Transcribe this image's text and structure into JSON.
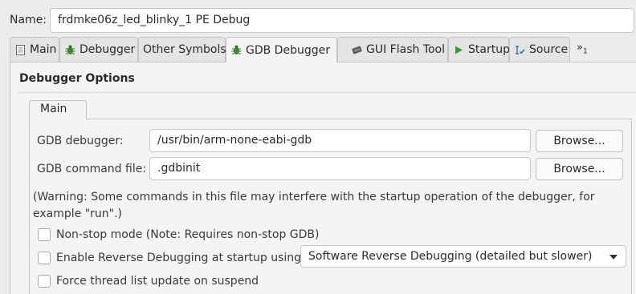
{
  "name": {
    "label": "Name:",
    "value": "frdmke06z_led_blinky_1 PE Debug"
  },
  "tabs": [
    {
      "label": "Main",
      "icon": "document-icon",
      "active": false
    },
    {
      "label": "Debugger",
      "icon": "bug-icon",
      "active": false
    },
    {
      "label": "Other Symbols",
      "icon": "",
      "active": false
    },
    {
      "label": "GDB Debugger",
      "icon": "bug-icon",
      "active": true
    },
    {
      "label": "GUI Flash Tool",
      "icon": "chip-icon",
      "active": false
    },
    {
      "label": "Startup",
      "icon": "play-icon",
      "active": false
    },
    {
      "label": "Source",
      "icon": "source-icon",
      "active": false
    }
  ],
  "more_tabs": {
    "label": "»",
    "count": "1"
  },
  "section": {
    "title": "Debugger Options"
  },
  "inner_tab": {
    "label": "Main"
  },
  "gdb_debugger": {
    "label": "GDB debugger:",
    "value": "/usr/bin/arm-none-eabi-gdb",
    "button": "Browse..."
  },
  "gdb_command_file": {
    "label": "GDB command file:",
    "value": ".gdbinit",
    "button": "Browse..."
  },
  "warning": {
    "line1": "(Warning: Some commands in this file may interfere with the startup operation of the debugger, for",
    "line2": "example \"run\".)"
  },
  "options": {
    "non_stop": {
      "label": "Non-stop mode (Note: Requires non-stop GDB)",
      "checked": false
    },
    "reverse": {
      "label": "Enable Reverse Debugging at startup using:",
      "checked": false
    },
    "reverse_mode": {
      "value": "Software Reverse Debugging (detailed but slower)"
    },
    "force_thread": {
      "label": "Force thread list update on suspend",
      "checked": false
    }
  },
  "colors": {
    "background": "#ececec",
    "panel": "#f4f4f4",
    "border": "#c4c4c4",
    "bug_icon": "#3d8a2e",
    "play_icon": "#3a9b3a"
  }
}
